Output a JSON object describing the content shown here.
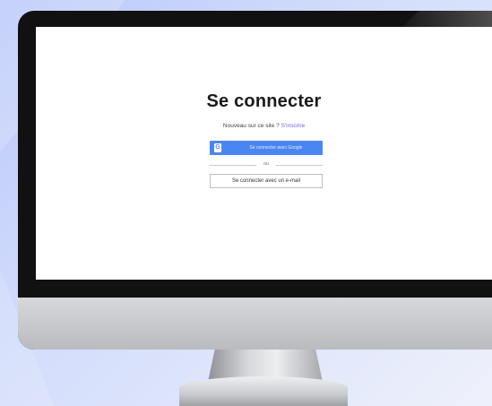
{
  "login": {
    "title": "Se connecter",
    "subtitle_prefix": "Nouveau sur ce site ?",
    "signup_link": "S'inscrire",
    "google_button": "Se connecter avec Google",
    "divider": "ou",
    "email_button": "Se connecter avec un e-mail"
  },
  "icons": {
    "google": "google-g-icon"
  },
  "colors": {
    "google_button_bg": "#4a86f2",
    "signup_link": "#7b5df0",
    "background": "#c8d4fb"
  }
}
